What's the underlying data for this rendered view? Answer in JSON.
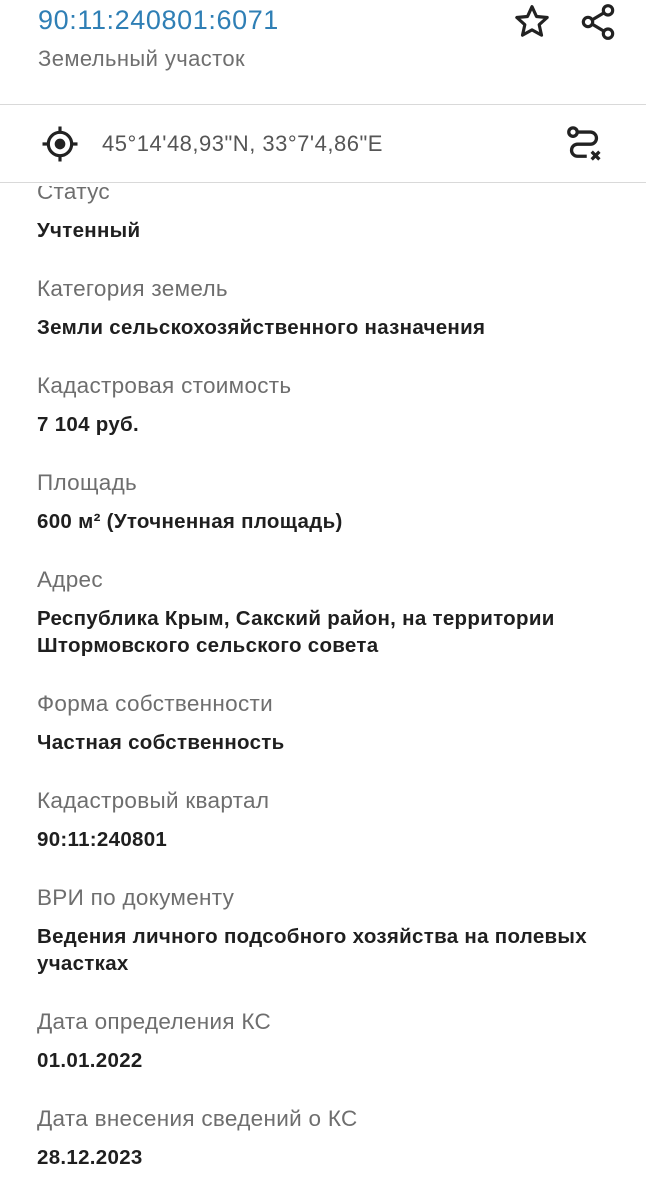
{
  "header": {
    "cadastral_number": "90:11:240801:6071",
    "object_type": "Земельный участок",
    "icons": {
      "favorite": "star-icon",
      "share": "share-icon"
    }
  },
  "location": {
    "coordinates": "45°14'48,93\"N, 33°7'4,86\"E",
    "icons": {
      "locate": "target-icon",
      "route": "route-icon"
    }
  },
  "fields": [
    {
      "label": "Статус",
      "value": "Учтенный"
    },
    {
      "label": "Категория земель",
      "value": "Земли сельскохозяйственного назначения"
    },
    {
      "label": "Кадастровая стоимость",
      "value": "7 104 руб."
    },
    {
      "label": "Площадь",
      "value": "600 м² (Уточненная площадь)"
    },
    {
      "label": "Адрес",
      "value": "Республика Крым, Сакский район, на территории Штормовского сельского совета"
    },
    {
      "label": "Форма собственности",
      "value": "Частная собственность"
    },
    {
      "label": "Кадастровый квартал",
      "value": "90:11:240801"
    },
    {
      "label": "ВРИ по документу",
      "value": "Ведения личного подсобного хозяйства на полевых участках"
    },
    {
      "label": "Дата определения КС",
      "value": "01.01.2022"
    },
    {
      "label": "Дата внесения сведений о КС",
      "value": "28.12.2023"
    }
  ],
  "colors": {
    "accent": "#2f7fb5",
    "label": "#6e6e6e",
    "value": "#1f1f1f",
    "divider": "#d9d9d9"
  }
}
